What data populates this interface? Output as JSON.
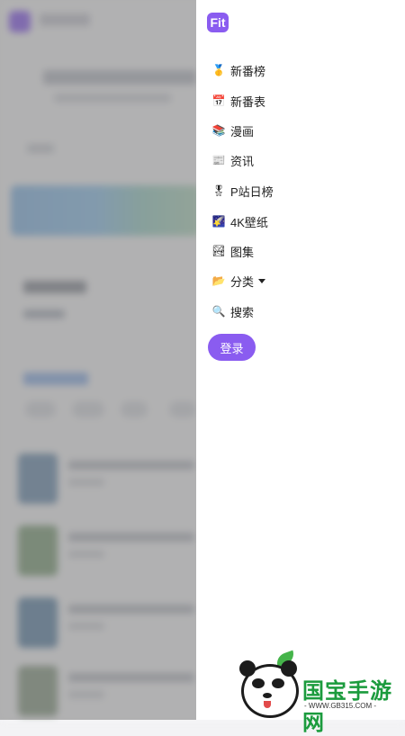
{
  "drawer": {
    "logo_text": "Fit",
    "menu": [
      {
        "icon": "🥇",
        "label": "新番榜",
        "name": "nav-new-anime-ranking",
        "icon_name": "gold-medal-icon"
      },
      {
        "icon": "📅",
        "label": "新番表",
        "name": "nav-new-anime-schedule",
        "icon_name": "calendar-icon"
      },
      {
        "icon": "📚",
        "label": "漫画",
        "name": "nav-comics",
        "icon_name": "books-icon"
      },
      {
        "icon": "📰",
        "label": "资讯",
        "name": "nav-news",
        "icon_name": "newspaper-icon"
      },
      {
        "icon": "🎖",
        "label": "P站日榜",
        "name": "nav-pixiv-daily",
        "icon_name": "military-medal-icon"
      },
      {
        "icon": "🌠",
        "label": "4K壁纸",
        "name": "nav-4k-wallpaper",
        "icon_name": "shooting-star-icon"
      },
      {
        "icon": "🏞",
        "label": "图集",
        "name": "nav-gallery",
        "icon_name": "landscape-icon"
      },
      {
        "icon": "📂",
        "label": "分类",
        "name": "nav-categories",
        "icon_name": "folder-icon"
      },
      {
        "icon": "🔍",
        "label": "搜索",
        "name": "nav-search",
        "icon_name": "search-icon"
      }
    ],
    "login_label": "登录"
  },
  "watermark": {
    "brand": "国宝手游网",
    "url": "- WWW.GB315.COM -"
  },
  "colors": {
    "accent": "#8a5cf0",
    "overlay": "rgba(120,120,120,0.55)",
    "watermark_green": "#1b9b3d"
  }
}
